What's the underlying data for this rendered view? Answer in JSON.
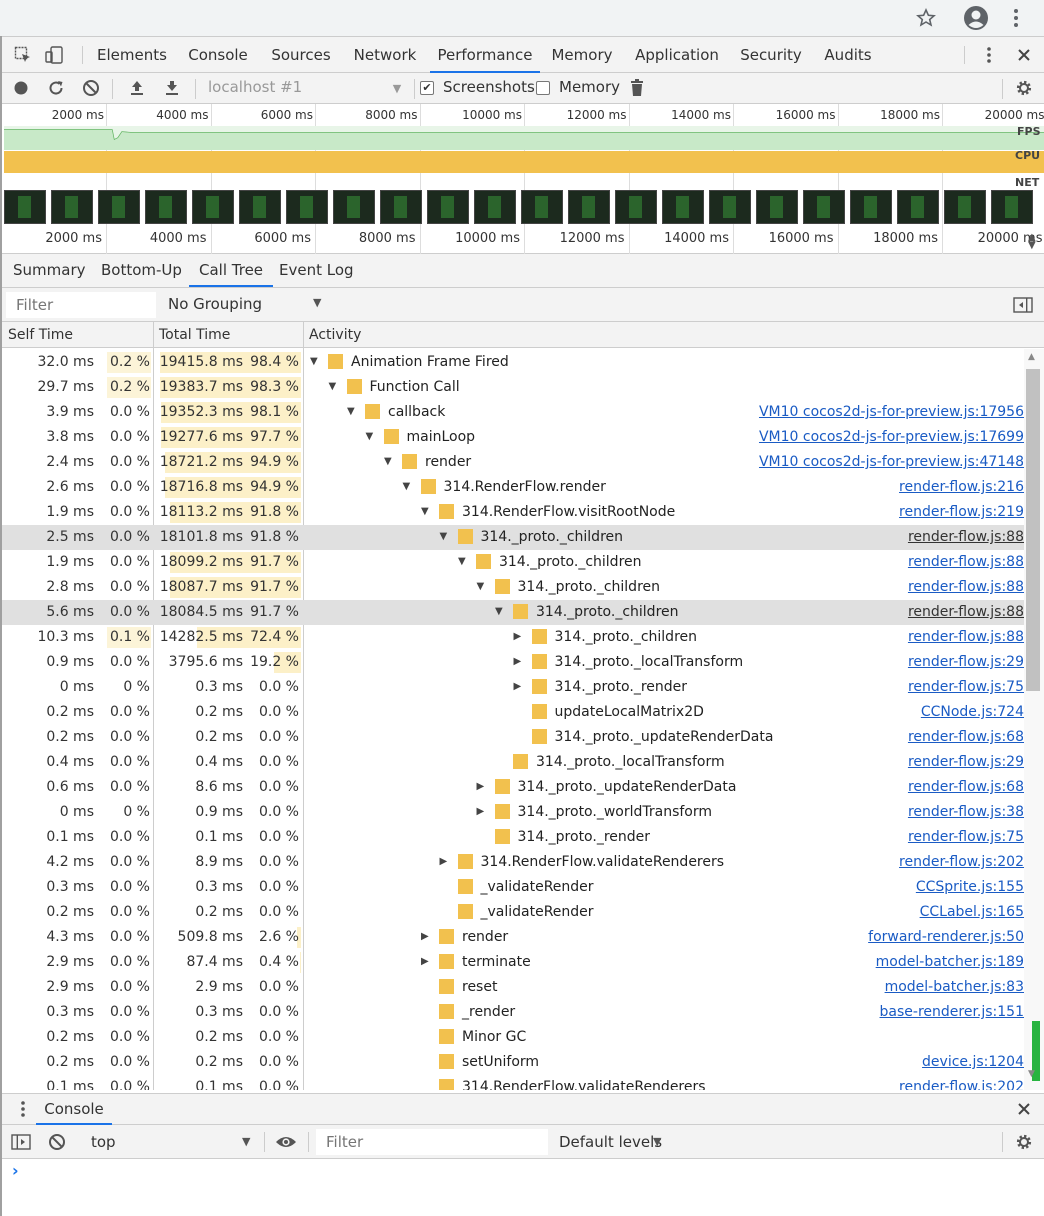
{
  "devtools": {
    "tabs": [
      "Elements",
      "Console",
      "Sources",
      "Network",
      "Performance",
      "Memory",
      "Application",
      "Security",
      "Audits"
    ],
    "active_tab": "Performance"
  },
  "perf_toolbar": {
    "target": "localhost #1",
    "screenshots_label": "Screenshots",
    "screenshots_checked": true,
    "memory_label": "Memory",
    "memory_checked": false
  },
  "overview": {
    "ticks": [
      "2000 ms",
      "4000 ms",
      "6000 ms",
      "8000 ms",
      "10000 ms",
      "12000 ms",
      "14000 ms",
      "16000 ms",
      "18000 ms",
      "20000 ms"
    ],
    "lane_fps": "FPS",
    "lane_cpu": "CPU",
    "lane_net": "NET",
    "cpu_color": "#f2c14e",
    "fps_color": "#8fd18f"
  },
  "sub_tabs": [
    "Summary",
    "Bottom-Up",
    "Call Tree",
    "Event Log"
  ],
  "active_sub_tab": "Call Tree",
  "filter": {
    "placeholder": "Filter",
    "grouping": "No Grouping"
  },
  "columns": {
    "self": "Self Time",
    "total": "Total Time",
    "activity": "Activity"
  },
  "rows": [
    {
      "self": "32.0 ms",
      "selfp": "0.2 %",
      "tot": "19415.8 ms",
      "totp": "98.4 %",
      "name": "Animation Frame Fired",
      "link": "",
      "depth": 0,
      "exp": "open",
      "sel": false
    },
    {
      "self": "29.7 ms",
      "selfp": "0.2 %",
      "tot": "19383.7 ms",
      "totp": "98.3 %",
      "name": "Function Call",
      "link": "",
      "depth": 1,
      "exp": "open",
      "sel": false
    },
    {
      "self": "3.9 ms",
      "selfp": "0.0 %",
      "tot": "19352.3 ms",
      "totp": "98.1 %",
      "name": "callback",
      "link": "VM10 cocos2d-js-for-preview.js:17956",
      "depth": 2,
      "exp": "open",
      "sel": false
    },
    {
      "self": "3.8 ms",
      "selfp": "0.0 %",
      "tot": "19277.6 ms",
      "totp": "97.7 %",
      "name": "mainLoop",
      "link": "VM10 cocos2d-js-for-preview.js:17699",
      "depth": 3,
      "exp": "open",
      "sel": false
    },
    {
      "self": "2.4 ms",
      "selfp": "0.0 %",
      "tot": "18721.2 ms",
      "totp": "94.9 %",
      "name": "render",
      "link": "VM10 cocos2d-js-for-preview.js:47148",
      "depth": 4,
      "exp": "open",
      "sel": false
    },
    {
      "self": "2.6 ms",
      "selfp": "0.0 %",
      "tot": "18716.8 ms",
      "totp": "94.9 %",
      "name": "314.RenderFlow.render",
      "link": "render-flow.js:216",
      "depth": 5,
      "exp": "open",
      "sel": false
    },
    {
      "self": "1.9 ms",
      "selfp": "0.0 %",
      "tot": "18113.2 ms",
      "totp": "91.8 %",
      "name": "314.RenderFlow.visitRootNode",
      "link": "render-flow.js:219",
      "depth": 6,
      "exp": "open",
      "sel": false
    },
    {
      "self": "2.5 ms",
      "selfp": "0.0 %",
      "tot": "18101.8 ms",
      "totp": "91.8 %",
      "name": "314._proto._children",
      "link": "render-flow.js:88",
      "depth": 7,
      "exp": "open",
      "sel": true
    },
    {
      "self": "1.9 ms",
      "selfp": "0.0 %",
      "tot": "18099.2 ms",
      "totp": "91.7 %",
      "name": "314._proto._children",
      "link": "render-flow.js:88",
      "depth": 8,
      "exp": "open",
      "sel": false
    },
    {
      "self": "2.8 ms",
      "selfp": "0.0 %",
      "tot": "18087.7 ms",
      "totp": "91.7 %",
      "name": "314._proto._children",
      "link": "render-flow.js:88",
      "depth": 9,
      "exp": "open",
      "sel": false
    },
    {
      "self": "5.6 ms",
      "selfp": "0.0 %",
      "tot": "18084.5 ms",
      "totp": "91.7 %",
      "name": "314._proto._children",
      "link": "render-flow.js:88",
      "depth": 10,
      "exp": "open",
      "sel": true
    },
    {
      "self": "10.3 ms",
      "selfp": "0.1 %",
      "tot": "14282.5 ms",
      "totp": "72.4 %",
      "name": "314._proto._children",
      "link": "render-flow.js:88",
      "depth": 11,
      "exp": "closed",
      "sel": false
    },
    {
      "self": "0.9 ms",
      "selfp": "0.0 %",
      "tot": "3795.6 ms",
      "totp": "19.2 %",
      "name": "314._proto._localTransform",
      "link": "render-flow.js:29",
      "depth": 11,
      "exp": "closed",
      "sel": false
    },
    {
      "self": "0 ms",
      "selfp": "0 %",
      "tot": "0.3 ms",
      "totp": "0.0 %",
      "name": "314._proto._render",
      "link": "render-flow.js:75",
      "depth": 11,
      "exp": "closed",
      "sel": false
    },
    {
      "self": "0.2 ms",
      "selfp": "0.0 %",
      "tot": "0.2 ms",
      "totp": "0.0 %",
      "name": "updateLocalMatrix2D",
      "link": "CCNode.js:724",
      "depth": 11,
      "exp": "none",
      "sel": false
    },
    {
      "self": "0.2 ms",
      "selfp": "0.0 %",
      "tot": "0.2 ms",
      "totp": "0.0 %",
      "name": "314._proto._updateRenderData",
      "link": "render-flow.js:68",
      "depth": 11,
      "exp": "none",
      "sel": false
    },
    {
      "self": "0.4 ms",
      "selfp": "0.0 %",
      "tot": "0.4 ms",
      "totp": "0.0 %",
      "name": "314._proto._localTransform",
      "link": "render-flow.js:29",
      "depth": 10,
      "exp": "none",
      "sel": false
    },
    {
      "self": "0.6 ms",
      "selfp": "0.0 %",
      "tot": "8.6 ms",
      "totp": "0.0 %",
      "name": "314._proto._updateRenderData",
      "link": "render-flow.js:68",
      "depth": 9,
      "exp": "closed",
      "sel": false
    },
    {
      "self": "0 ms",
      "selfp": "0 %",
      "tot": "0.9 ms",
      "totp": "0.0 %",
      "name": "314._proto._worldTransform",
      "link": "render-flow.js:38",
      "depth": 9,
      "exp": "closed",
      "sel": false
    },
    {
      "self": "0.1 ms",
      "selfp": "0.0 %",
      "tot": "0.1 ms",
      "totp": "0.0 %",
      "name": "314._proto._render",
      "link": "render-flow.js:75",
      "depth": 9,
      "exp": "none",
      "sel": false
    },
    {
      "self": "4.2 ms",
      "selfp": "0.0 %",
      "tot": "8.9 ms",
      "totp": "0.0 %",
      "name": "314.RenderFlow.validateRenderers",
      "link": "render-flow.js:202",
      "depth": 7,
      "exp": "closed",
      "sel": false
    },
    {
      "self": "0.3 ms",
      "selfp": "0.0 %",
      "tot": "0.3 ms",
      "totp": "0.0 %",
      "name": "_validateRender",
      "link": "CCSprite.js:155",
      "depth": 7,
      "exp": "none",
      "sel": false
    },
    {
      "self": "0.2 ms",
      "selfp": "0.0 %",
      "tot": "0.2 ms",
      "totp": "0.0 %",
      "name": "_validateRender",
      "link": "CCLabel.js:165",
      "depth": 7,
      "exp": "none",
      "sel": false
    },
    {
      "self": "4.3 ms",
      "selfp": "0.0 %",
      "tot": "509.8 ms",
      "totp": "2.6 %",
      "name": "render",
      "link": "forward-renderer.js:50",
      "depth": 6,
      "exp": "closed",
      "sel": false
    },
    {
      "self": "2.9 ms",
      "selfp": "0.0 %",
      "tot": "87.4 ms",
      "totp": "0.4 %",
      "name": "terminate",
      "link": "model-batcher.js:189",
      "depth": 6,
      "exp": "closed",
      "sel": false
    },
    {
      "self": "2.9 ms",
      "selfp": "0.0 %",
      "tot": "2.9 ms",
      "totp": "0.0 %",
      "name": "reset",
      "link": "model-batcher.js:83",
      "depth": 6,
      "exp": "none",
      "sel": false
    },
    {
      "self": "0.3 ms",
      "selfp": "0.0 %",
      "tot": "0.3 ms",
      "totp": "0.0 %",
      "name": "_render",
      "link": "base-renderer.js:151",
      "depth": 6,
      "exp": "none",
      "sel": false
    },
    {
      "self": "0.2 ms",
      "selfp": "0.0 %",
      "tot": "0.2 ms",
      "totp": "0.0 %",
      "name": "Minor GC",
      "link": "",
      "depth": 6,
      "exp": "none",
      "sel": false
    },
    {
      "self": "0.2 ms",
      "selfp": "0.0 %",
      "tot": "0.2 ms",
      "totp": "0.0 %",
      "name": "setUniform",
      "link": "device.js:1204",
      "depth": 6,
      "exp": "none",
      "sel": false
    },
    {
      "self": "0.1 ms",
      "selfp": "0.0 %",
      "tot": "0.1 ms",
      "totp": "0.0 %",
      "name": "314.RenderFlow.validateRenderers",
      "link": "render-flow.js:202",
      "depth": 6,
      "exp": "none",
      "sel": false
    }
  ],
  "console": {
    "tab": "Console",
    "context": "top",
    "filter_placeholder": "Filter",
    "levels": "Default levels",
    "prompt": "›"
  }
}
